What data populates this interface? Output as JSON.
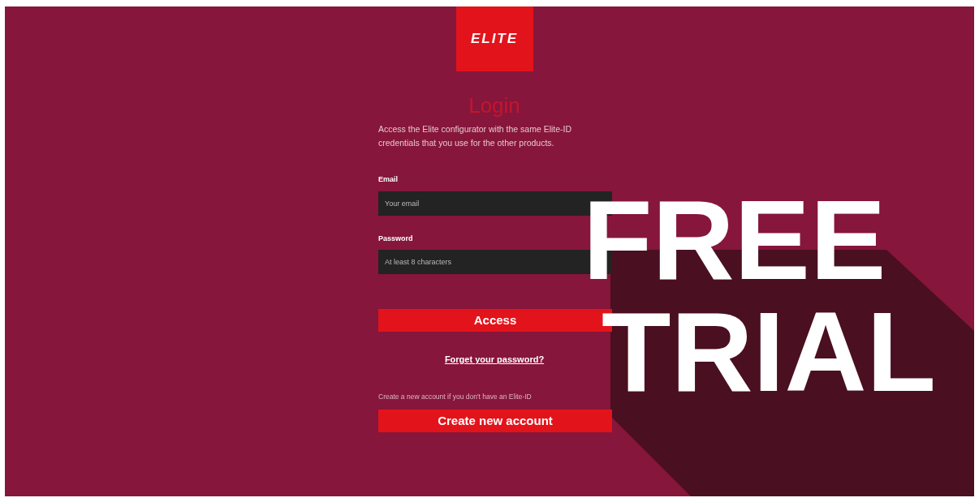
{
  "logo": {
    "text": "ELITE"
  },
  "title": "Login",
  "intro": "Access the Elite configurator with the same Elite-ID credentials that you use for the other products.",
  "fields": [
    {
      "label": "Email",
      "placeholder": "Your email"
    },
    {
      "label": "Password",
      "placeholder": "At least 8 characters"
    }
  ],
  "access_button": "Access",
  "forgot_link": "Forget your password?",
  "create_hint": "Create a new account if you don't have an Elite-ID",
  "create_button": "Create new account",
  "banner": [
    "FREE",
    "TRIAL"
  ]
}
